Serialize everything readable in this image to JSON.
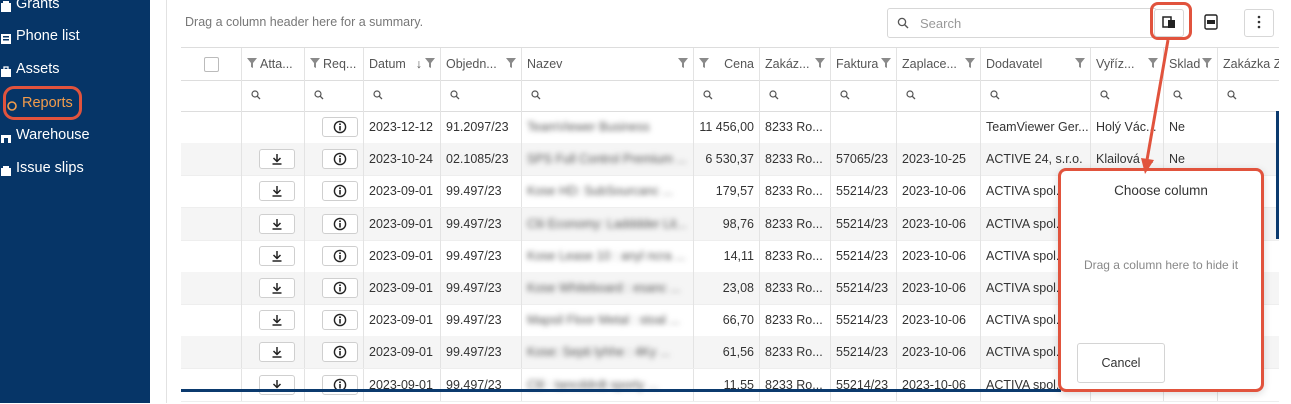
{
  "sidebar": {
    "items": [
      {
        "label": "Grants",
        "icon": "grants-icon"
      },
      {
        "label": "Phone list",
        "icon": "phone-list-icon"
      },
      {
        "label": "Assets",
        "icon": "assets-icon"
      },
      {
        "label": "Reports",
        "icon": "reports-icon",
        "active": true
      },
      {
        "label": "Warehouse",
        "icon": "warehouse-icon"
      },
      {
        "label": "Issue slips",
        "icon": "issue-slips-icon"
      }
    ]
  },
  "toolbar": {
    "group_hint": "Drag a column header here for a summary.",
    "search_placeholder": "Search"
  },
  "grid": {
    "headers": [
      "Atta...",
      "Req...",
      "Datum",
      "Objedn...",
      "Nazev",
      "Cena",
      "Zakáz...",
      "Faktura",
      "Zaplace...",
      "Dodavatel",
      "Vyříz...",
      "Sklad",
      "Zakázka Z"
    ],
    "rows": [
      {
        "att": false,
        "datum": "2023-12-12",
        "obj": "91.2097/23",
        "nazev": "TeamViewer Business",
        "cena": "11 456,00",
        "zak": "8233 Ro...",
        "faktura": "",
        "zapl": "",
        "dod": "TeamViewer Ger...",
        "vyr": "Holý Vác...",
        "sklad": "Ne"
      },
      {
        "att": true,
        "datum": "2023-10-24",
        "obj": "02.1085/23",
        "nazev": "SPS Full Control Premium ...",
        "cena": "6 530,37",
        "zak": "8233 Ro...",
        "faktura": "57065/23",
        "zapl": "2023-10-25",
        "dod": "ACTIVE 24, s.r.o.",
        "vyr": "Klailová ...",
        "sklad": "Ne"
      },
      {
        "att": true,
        "datum": "2023-09-01",
        "obj": "99.497/23",
        "nazev": "Kose HD: SubSourcanc ...",
        "cena": "179,57",
        "zak": "8233 Ro...",
        "faktura": "55214/23",
        "zapl": "2023-10-06",
        "dod": "ACTIVA spol.",
        "vyr": "",
        "sklad": ""
      },
      {
        "att": true,
        "datum": "2023-09-01",
        "obj": "99.497/23",
        "nazev": "Clii Economy: Ladddder Lit...",
        "cena": "98,76",
        "zak": "8233 Ro...",
        "faktura": "55214/23",
        "zapl": "2023-10-06",
        "dod": "ACTIVA spol.",
        "vyr": "",
        "sklad": ""
      },
      {
        "att": true,
        "datum": "2023-09-01",
        "obj": "99.497/23",
        "nazev": "Kose Lease 10 : anyl ncra ...",
        "cena": "14,11",
        "zak": "8233 Ro...",
        "faktura": "55214/23",
        "zapl": "2023-10-06",
        "dod": "ACTIVA spol.",
        "vyr": "",
        "sklad": ""
      },
      {
        "att": true,
        "datum": "2023-09-01",
        "obj": "99.497/23",
        "nazev": "Kose Whiteboard : esanc ...",
        "cena": "23,08",
        "zak": "8233 Ro...",
        "faktura": "55214/23",
        "zapl": "2023-10-06",
        "dod": "ACTIVA spol.",
        "vyr": "",
        "sklad": ""
      },
      {
        "att": true,
        "datum": "2023-09-01",
        "obj": "99.497/23",
        "nazev": "Mapsil Floor Metal : stoal ...",
        "cena": "66,70",
        "zak": "8233 Ro...",
        "faktura": "55214/23",
        "zapl": "2023-10-06",
        "dod": "ACTIVA spol.",
        "vyr": "",
        "sklad": ""
      },
      {
        "att": true,
        "datum": "2023-09-01",
        "obj": "99.497/23",
        "nazev": "Kose: Septi lyhhe : 4Ky ...",
        "cena": "61,56",
        "zak": "8233 Ro...",
        "faktura": "55214/23",
        "zapl": "2023-10-06",
        "dod": "ACTIVA spol.",
        "vyr": "",
        "sklad": ""
      },
      {
        "att": true,
        "datum": "2023-09-01",
        "obj": "99.497/23",
        "nazev": "Clil : tancddrdt sporty ...",
        "cena": "11,55",
        "zak": "8233 Ro...",
        "faktura": "55214/23",
        "zapl": "2023-10-06",
        "dod": "ACTIVA spol.",
        "vyr": "",
        "sklad": ""
      }
    ]
  },
  "chooser": {
    "title": "Choose column",
    "hint": "Drag a column here to hide it",
    "cancel_label": "Cancel"
  },
  "colors": {
    "sidebar_bg": "#063567",
    "highlight": "#e1533d",
    "active_text": "#f29c4b",
    "accent": "#0b3a6e"
  }
}
